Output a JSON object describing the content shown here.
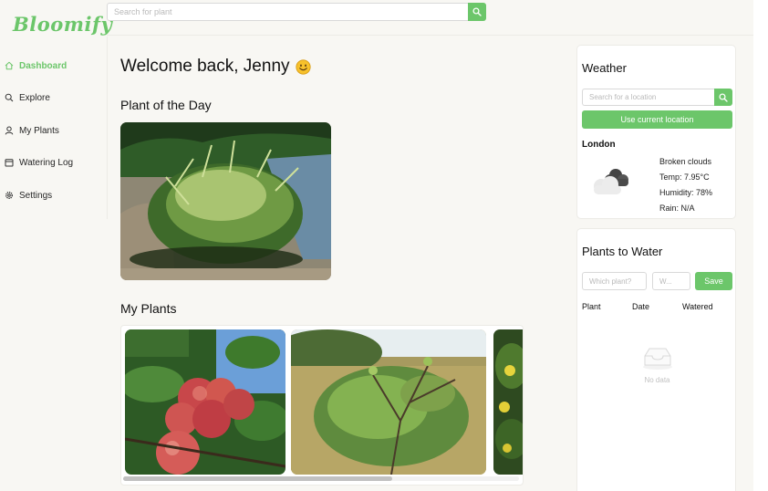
{
  "app": {
    "logo": "Bloomify",
    "brand_color": "#6cc66a"
  },
  "search": {
    "placeholder": "Search for plant",
    "icon": "search-icon"
  },
  "sidebar": {
    "items": [
      {
        "label": "Dashboard",
        "icon": "home-icon",
        "active": true
      },
      {
        "label": "Explore",
        "icon": "search-icon",
        "active": false
      },
      {
        "label": "My Plants",
        "icon": "user-icon",
        "active": false
      },
      {
        "label": "Watering Log",
        "icon": "calendar-icon",
        "active": false
      },
      {
        "label": "Settings",
        "icon": "gear-icon",
        "active": false
      }
    ]
  },
  "main": {
    "welcome": "Welcome back, Jenny",
    "welcome_emoji": "smiley-icon",
    "plant_of_day_title": "Plant of the Day",
    "plant_of_day_image": "ornamental-grass-photo",
    "my_plants_title": "My Plants",
    "my_plants": [
      {
        "image": "apple-tree-photo"
      },
      {
        "image": "wild-shrub-photo"
      },
      {
        "image": "yellow-flower-photo"
      }
    ]
  },
  "weather": {
    "title": "Weather",
    "location_placeholder": "Search for a location",
    "use_location_label": "Use current location",
    "city": "London",
    "condition": "Broken clouds",
    "temp": "Temp: 7.95°C",
    "humidity": "Humidity: 78%",
    "rain": "Rain: N/A",
    "icon": "cloud-icon"
  },
  "water": {
    "title": "Plants to Water",
    "plant_placeholder": "Which plant?",
    "date_placeholder": "W...",
    "save_label": "Save",
    "columns": [
      "Plant",
      "Date",
      "Watered"
    ],
    "empty_text": "No data"
  }
}
